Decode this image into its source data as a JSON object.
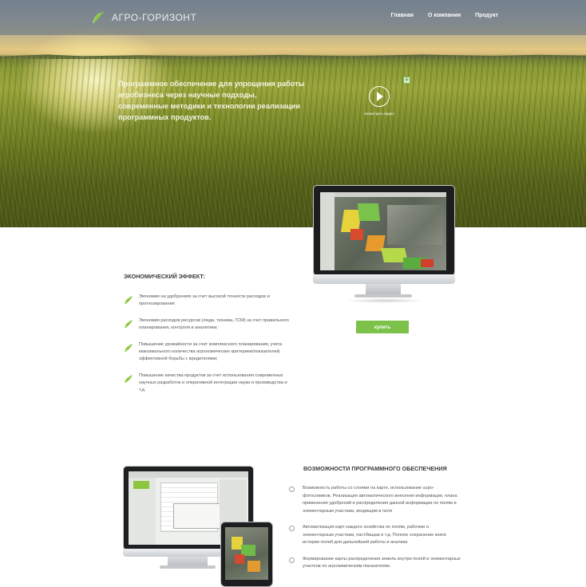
{
  "brand": {
    "name": "АГРО-ГОРИЗОНТ",
    "accent_color": "#7cc24a",
    "logo_icon": "wheat-leaf-icon"
  },
  "nav": {
    "items": [
      "Главная",
      "О компании",
      "Продукт"
    ]
  },
  "hero": {
    "headline": "Программное обеспечение для упрощения работы агробизнеса через научные подходы, современные методики и технологии реализации программных продуктов.",
    "video_label": "посмотреть видео",
    "play_icon": "play-circle-icon"
  },
  "cta": {
    "buy_label": "купить"
  },
  "economic_effect": {
    "title": "ЭКОНОМИЧЕСКИЙ ЭФФЕКТ:",
    "items": [
      "Экономия на удобрениях за счет высокой точности расходов и прогнозирования",
      "Экономия расходов ресурсов (люди, техника, ГСМ) за счет правильного планирования, контроля и аналитики;",
      "Повышение урожайности за счет комплексного планирования, учета максимального количества агрономических критериев/показателей, эффективной борьбы с вредителями;",
      "Повышение качества продуктов за счет использования современных научных разработок и оперативной интеграции науки и производства и т.д."
    ]
  },
  "software": {
    "title": "ВОЗМОЖНОСТИ ПРОГРАММНОГО ОБЕСПЕЧЕНИЯ",
    "items": [
      "Возможность работы со слоями на карте, использование аэро-фотоснимков. Реализация автоматического внесения информации, плана применения удобрений и распределения данной информации по полям и элементарным участкам, входящим в поля",
      "Автоматизация карт каждого хозяйства по полям, рабочим и элементарным участкам, пастбищам и т.д. Полное сохранение книги истории полей для дальнейшей работы и анализа",
      "Формирование карты распределения земель внутри полей и элементарных участков по агрохимическим показателям."
    ]
  }
}
